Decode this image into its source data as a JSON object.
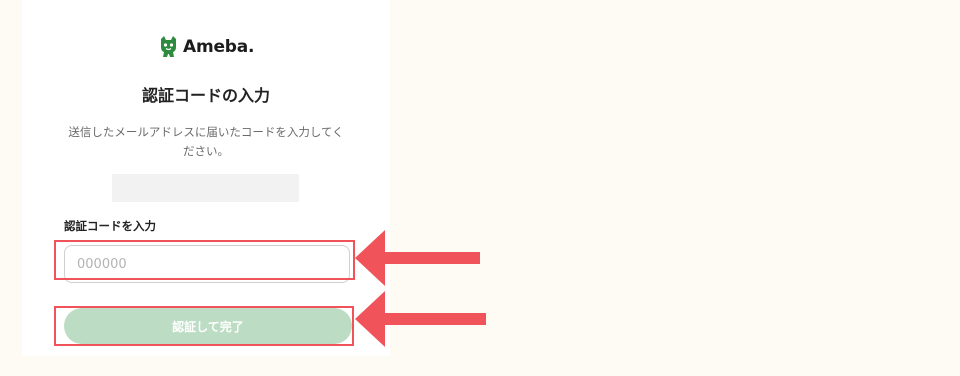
{
  "colors": {
    "page_background": "#fdfbf3",
    "brand_green": "#2d8a3e",
    "button_disabled": "#bcdcc4",
    "annotation_red": "#f0545a"
  },
  "header": {
    "logo_icon": "ameba-mascot-icon",
    "logo_text": "Ameba."
  },
  "main": {
    "title": "認証コードの入力",
    "description_line1": "送信したメールアドレスに届いたコードを入力してく",
    "description_line2": "ださい。",
    "code_field": {
      "label": "認証コードを入力",
      "placeholder": "000000",
      "value": ""
    },
    "submit_label": "認証して完了"
  },
  "annotations": {
    "arrow_icon": "arrow-left-icon"
  }
}
